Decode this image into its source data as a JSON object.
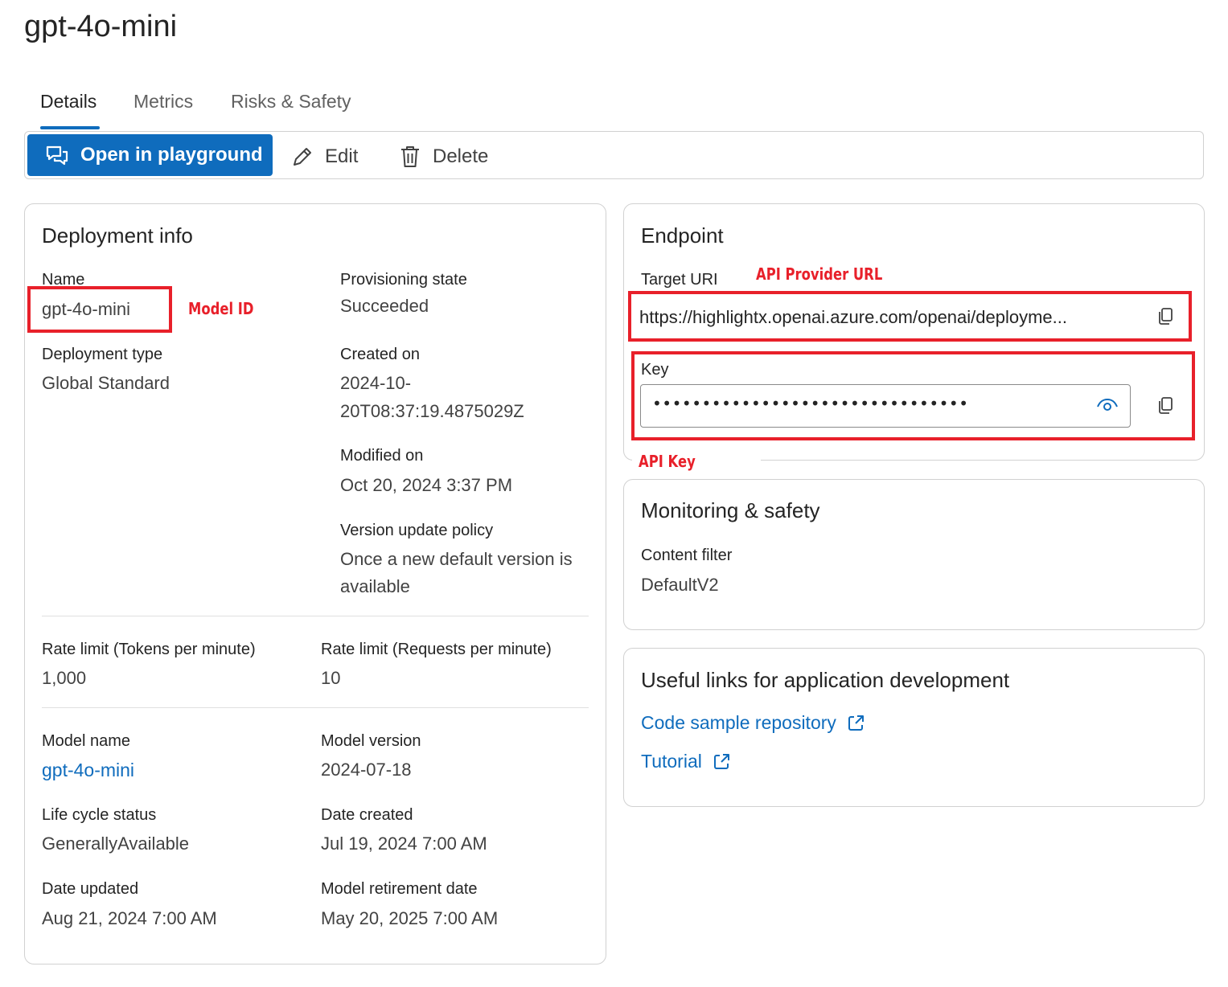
{
  "page": {
    "title": "gpt-4o-mini"
  },
  "tabs": [
    {
      "label": "Details",
      "active": true
    },
    {
      "label": "Metrics",
      "active": false
    },
    {
      "label": "Risks & Safety",
      "active": false
    }
  ],
  "toolbar": {
    "open_playground": "Open in playground",
    "edit": "Edit",
    "delete": "Delete"
  },
  "deployment": {
    "title": "Deployment info",
    "name_label": "Name",
    "name_value": "gpt-4o-mini",
    "type_label": "Deployment type",
    "type_value": "Global Standard",
    "state_label": "Provisioning state",
    "state_value": "Succeeded",
    "created_label": "Created on",
    "created_value_line1": "2024-10-",
    "created_value_line2": "20T08:37:19.4875029Z",
    "modified_label": "Modified on",
    "modified_value": "Oct 20, 2024 3:37 PM",
    "policy_label": "Version update policy",
    "policy_value_line1": "Once a new default version is",
    "policy_value_line2": "available",
    "tpm_label": "Rate limit (Tokens per minute)",
    "tpm_value": "1,000",
    "rpm_label": "Rate limit (Requests per minute)",
    "rpm_value": "10",
    "model_name_label": "Model name",
    "model_name_value": "gpt-4o-mini",
    "model_version_label": "Model version",
    "model_version_value": "2024-07-18",
    "lifecycle_label": "Life cycle status",
    "lifecycle_value": "GenerallyAvailable",
    "date_created_label": "Date created",
    "date_created_value": "Jul 19, 2024 7:00 AM",
    "date_updated_label": "Date updated",
    "date_updated_value": "Aug 21, 2024 7:00 AM",
    "retirement_label": "Model retirement date",
    "retirement_value": "May 20, 2025 7:00 AM"
  },
  "endpoint": {
    "title": "Endpoint",
    "target_uri_label": "Target URI",
    "target_uri_value": "https://highlightx.openai.azure.com/openai/deployme...",
    "key_label": "Key",
    "key_value": "••••••••••••••••••••••••••••••••"
  },
  "monitoring": {
    "title": "Monitoring & safety",
    "content_filter_label": "Content filter",
    "content_filter_value": "DefaultV2"
  },
  "links": {
    "title": "Useful links for application development",
    "code_sample": "Code sample repository",
    "tutorial": "Tutorial"
  },
  "annotations": {
    "model_id": "Model ID",
    "api_provider_url": "API Provider URL",
    "api_key": "API Key"
  },
  "colors": {
    "accent": "#0f6cbd",
    "annotation_red": "#e8202a",
    "border": "#d1d1d1"
  }
}
